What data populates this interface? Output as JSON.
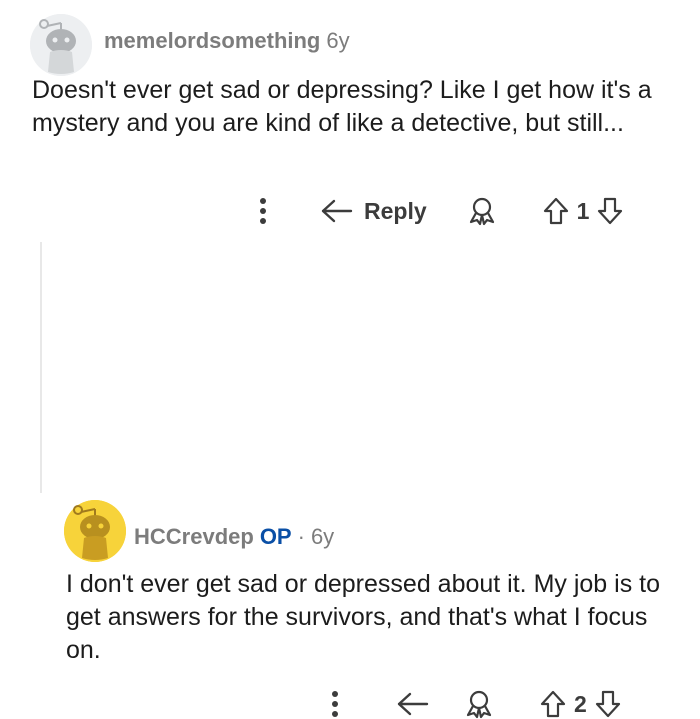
{
  "comments": [
    {
      "username": "memelordsomething",
      "age": "6y",
      "body": "Doesn't ever get sad or depressing? Like I get how it's a mystery and you are kind of like a detective, but still...",
      "reply_label": "Reply",
      "score": "1",
      "avatar_color": "#edeff1"
    },
    {
      "username": "HCCrevdep",
      "op_badge": "OP",
      "separator": "·",
      "age": "6y",
      "body": "I don't ever get sad or depressed about it. My job is to get answers for the survivors, and that's what I focus on.",
      "score": "2",
      "avatar_color": "#f7d33a"
    }
  ],
  "colors": {
    "meta_text": "#7c7c7c",
    "op_badge": "#0a4fa6",
    "thread_line": "#e8e8e8"
  },
  "icons": [
    "more-vertical-icon",
    "reply-arrow-icon",
    "award-icon",
    "upvote-icon",
    "downvote-icon",
    "snoo-avatar-icon"
  ]
}
